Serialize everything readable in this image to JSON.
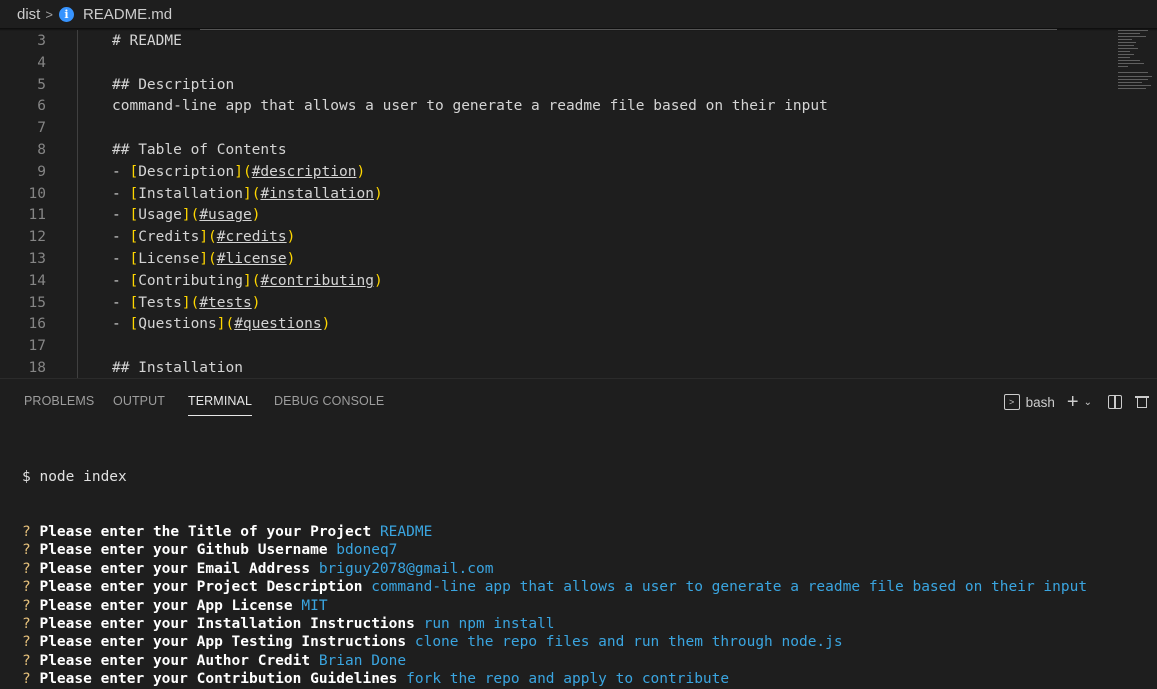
{
  "breadcrumb": {
    "folder": "dist",
    "separator": ">",
    "file": "README.md"
  },
  "editor": {
    "lines": [
      {
        "num": "3",
        "parts": [
          {
            "t": "# README",
            "c": "h"
          }
        ]
      },
      {
        "num": "4",
        "parts": []
      },
      {
        "num": "5",
        "parts": [
          {
            "t": "## Description",
            "c": "h"
          }
        ]
      },
      {
        "num": "6",
        "parts": [
          {
            "t": "command-line app that allows a user to generate a readme file based on their input",
            "c": "h"
          }
        ]
      },
      {
        "num": "7",
        "parts": []
      },
      {
        "num": "8",
        "parts": [
          {
            "t": "## Table of Contents",
            "c": "h"
          }
        ]
      },
      {
        "num": "9",
        "parts": [
          {
            "t": "- ",
            "c": "punct"
          },
          {
            "t": "[",
            "c": "lt"
          },
          {
            "t": "Description",
            "c": "h"
          },
          {
            "t": "](",
            "c": "lt"
          },
          {
            "t": "#description",
            "c": "lu"
          },
          {
            "t": ")",
            "c": "lt"
          }
        ]
      },
      {
        "num": "10",
        "parts": [
          {
            "t": "- ",
            "c": "punct"
          },
          {
            "t": "[",
            "c": "lt"
          },
          {
            "t": "Installation",
            "c": "h"
          },
          {
            "t": "](",
            "c": "lt"
          },
          {
            "t": "#installation",
            "c": "lu"
          },
          {
            "t": ")",
            "c": "lt"
          }
        ]
      },
      {
        "num": "11",
        "parts": [
          {
            "t": "- ",
            "c": "punct"
          },
          {
            "t": "[",
            "c": "lt"
          },
          {
            "t": "Usage",
            "c": "h"
          },
          {
            "t": "](",
            "c": "lt"
          },
          {
            "t": "#usage",
            "c": "lu"
          },
          {
            "t": ")",
            "c": "lt"
          }
        ]
      },
      {
        "num": "12",
        "parts": [
          {
            "t": "- ",
            "c": "punct"
          },
          {
            "t": "[",
            "c": "lt"
          },
          {
            "t": "Credits",
            "c": "h"
          },
          {
            "t": "](",
            "c": "lt"
          },
          {
            "t": "#credits",
            "c": "lu"
          },
          {
            "t": ")",
            "c": "lt"
          }
        ]
      },
      {
        "num": "13",
        "parts": [
          {
            "t": "- ",
            "c": "punct"
          },
          {
            "t": "[",
            "c": "lt"
          },
          {
            "t": "License",
            "c": "h"
          },
          {
            "t": "](",
            "c": "lt"
          },
          {
            "t": "#license",
            "c": "lu"
          },
          {
            "t": ")",
            "c": "lt"
          }
        ]
      },
      {
        "num": "14",
        "parts": [
          {
            "t": "- ",
            "c": "punct"
          },
          {
            "t": "[",
            "c": "lt"
          },
          {
            "t": "Contributing",
            "c": "h"
          },
          {
            "t": "](",
            "c": "lt"
          },
          {
            "t": "#contributing",
            "c": "lu"
          },
          {
            "t": ")",
            "c": "lt"
          }
        ]
      },
      {
        "num": "15",
        "parts": [
          {
            "t": "- ",
            "c": "punct"
          },
          {
            "t": "[",
            "c": "lt"
          },
          {
            "t": "Tests",
            "c": "h"
          },
          {
            "t": "](",
            "c": "lt"
          },
          {
            "t": "#tests",
            "c": "lu"
          },
          {
            "t": ")",
            "c": "lt"
          }
        ]
      },
      {
        "num": "16",
        "parts": [
          {
            "t": "- ",
            "c": "punct"
          },
          {
            "t": "[",
            "c": "lt"
          },
          {
            "t": "Questions",
            "c": "h"
          },
          {
            "t": "](",
            "c": "lt"
          },
          {
            "t": "#questions",
            "c": "lu"
          },
          {
            "t": ")",
            "c": "lt"
          }
        ]
      },
      {
        "num": "17",
        "parts": []
      },
      {
        "num": "18",
        "parts": [
          {
            "t": "## Installation",
            "c": "h"
          }
        ]
      }
    ]
  },
  "panel": {
    "tabs": [
      {
        "label": "PROBLEMS",
        "active": false
      },
      {
        "label": "OUTPUT",
        "active": false
      },
      {
        "label": "TERMINAL",
        "active": true
      },
      {
        "label": "DEBUG CONSOLE",
        "active": false
      }
    ],
    "shell_label": "bash",
    "shell_icon": ">",
    "new_terminal_icon": "+",
    "dropdown_icon": "⌄"
  },
  "terminal": {
    "command_line": "$ node index",
    "prompt_symbol": "?",
    "entries": [
      {
        "question": "Please enter the Title of your Project",
        "answer": "README"
      },
      {
        "question": "Please enter your Github Username",
        "answer": "bdoneq7"
      },
      {
        "question": "Please enter your Email Address",
        "answer": "briguy2078@gmail.com"
      },
      {
        "question": "Please enter your Project Description",
        "answer": "command-line app that allows a user to generate a readme file based on their input"
      },
      {
        "question": "Please enter your App License",
        "answer": "MIT"
      },
      {
        "question": "Please enter your Installation Instructions",
        "answer": "run npm install"
      },
      {
        "question": "Please enter your App Testing Instructions",
        "answer": "clone the repo files and run them through node.js"
      },
      {
        "question": "Please enter your Author Credit",
        "answer": "Brian Done"
      },
      {
        "question": "Please enter your Contribution Guidelines",
        "answer": "fork the repo and apply to contribute"
      }
    ]
  },
  "colors": {
    "background": "#1e1e1e",
    "link_bracket": "#ffd700",
    "answer": "#3aa5e0",
    "prompt_question_mark": "#e5c07b",
    "info_icon": "#3794ff"
  }
}
